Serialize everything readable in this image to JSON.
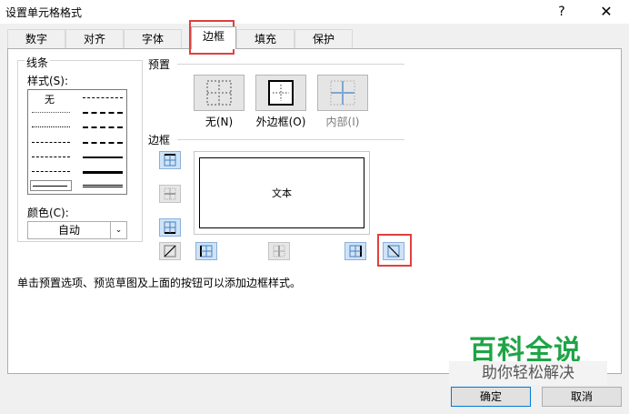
{
  "dialog": {
    "title": "设置单元格格式",
    "help_label": "?",
    "close_label": "✕"
  },
  "tabs": [
    {
      "label": "数字"
    },
    {
      "label": "对齐"
    },
    {
      "label": "字体"
    },
    {
      "label": "边框",
      "active": true
    },
    {
      "label": "填充"
    },
    {
      "label": "保护"
    }
  ],
  "line": {
    "group_label": "线条",
    "style_label": "样式(S):",
    "none_label": "无",
    "color_label": "颜色(C):",
    "color_value": "自动",
    "color_arrow": "⌄"
  },
  "presets": {
    "group_label": "预置",
    "items": [
      {
        "label": "无(N)"
      },
      {
        "label": "外边框(O)"
      },
      {
        "label": "内部(I)"
      }
    ]
  },
  "border": {
    "group_label": "边框",
    "preview_text": "文本"
  },
  "hint": "单击预置选项、预览草图及上面的按钮可以添加边框样式。",
  "watermark": {
    "title": "百科全说",
    "subtitle": "助你轻松解决"
  },
  "buttons": {
    "ok": "确定",
    "cancel": "取消"
  },
  "colors": {
    "highlight": "#e0403f",
    "watermark": "#1ea446",
    "accent": "#0078d7"
  }
}
